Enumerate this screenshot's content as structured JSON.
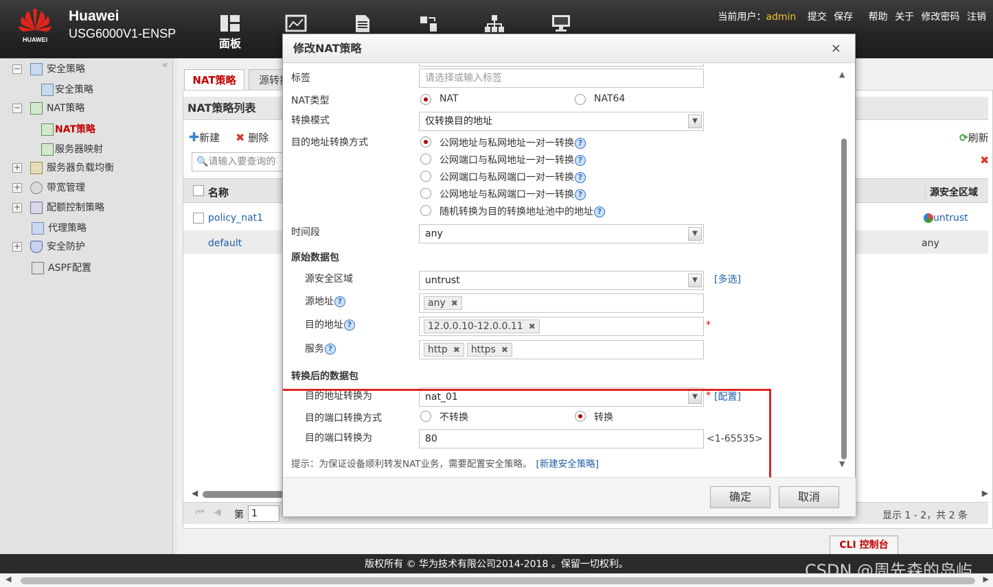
{
  "header": {
    "logo_text": "HUAWEI",
    "brand_line1": "Huawei",
    "brand_line2": "USG6000V1-ENSP",
    "nav": [
      {
        "label": "面板",
        "icon": "dashboard-icon"
      },
      {
        "label": "监控",
        "icon": "monitor-chart-icon"
      },
      {
        "label": "策略",
        "icon": "document-icon"
      },
      {
        "label": "对象",
        "icon": "object-icon"
      },
      {
        "label": "网络",
        "icon": "network-icon"
      },
      {
        "label": "系统",
        "icon": "computer-icon"
      }
    ],
    "user_prefix": "当前用户：",
    "user": "admin",
    "links": [
      "提交",
      "保存",
      "帮助",
      "关于",
      "修改密码",
      "注销"
    ]
  },
  "sidebar": {
    "collapse": "«",
    "items": [
      {
        "label": "安全策略",
        "expander": "−"
      },
      {
        "label": "安全策略"
      },
      {
        "label": "NAT策略",
        "expander": "−"
      },
      {
        "label": "NAT策略"
      },
      {
        "label": "服务器映射"
      },
      {
        "label": "服务器负载均衡",
        "expander": "+"
      },
      {
        "label": "带宽管理",
        "expander": "+"
      },
      {
        "label": "配额控制策略",
        "expander": "+"
      },
      {
        "label": "代理策略"
      },
      {
        "label": "安全防护",
        "expander": "+"
      },
      {
        "label": "ASPF配置"
      }
    ]
  },
  "main": {
    "tabs": [
      "NAT策略",
      "源转换"
    ],
    "list_title": "NAT策略列表",
    "toolbar": {
      "new": "新建",
      "delete": "删除",
      "refresh": "刷新"
    },
    "search_placeholder": "请输入要查询的",
    "columns": {
      "name": "名称",
      "src_zone": "源安全区域"
    },
    "rows": [
      {
        "name": "policy_nat1",
        "src_zone": "untrust"
      },
      {
        "name": "default",
        "src_zone": "any"
      }
    ],
    "pager": {
      "page_label": "第",
      "page": "1",
      "summary": "显示 1 - 2，共 2 条"
    },
    "cli": "CLI 控制台"
  },
  "dialog": {
    "title": "修改NAT策略",
    "close": "×",
    "fields": {
      "label_tag": "标签",
      "tag_placeholder": "请选择或输入标签",
      "label_nat_type": "NAT类型",
      "nat_opt1": "NAT",
      "nat_opt2": "NAT64",
      "label_mode": "转换模式",
      "mode_value": "仅转换目的地址",
      "label_dst_method": "目的地址转换方式",
      "dst_opts": [
        "公网地址与私网地址一对一转换",
        "公网端口与私网地址一对一转换",
        "公网端口与私网端口一对一转换",
        "公网地址与私网端口一对一转换",
        "随机转换为目的转换地址池中的地址"
      ],
      "label_time": "时间段",
      "time_value": "any",
      "section_orig": "原始数据包",
      "label_src_zone": "源安全区域",
      "src_zone_value": "untrust",
      "multi_link": "[多选]",
      "label_src_addr": "源地址",
      "src_addr_tags": [
        "any"
      ],
      "label_dst_addr": "目的地址",
      "dst_addr_tags": [
        "12.0.0.10-12.0.0.11"
      ],
      "label_service": "服务",
      "service_tags": [
        "http",
        "https"
      ],
      "section_trans": "转换后的数据包",
      "label_dst_to": "目的地址转换为",
      "dst_to_value": "nat_01",
      "config_link": "[配置]",
      "label_port_method": "目的端口转换方式",
      "port_opt1": "不转换",
      "port_opt2": "转换",
      "label_port_to": "目的端口转换为",
      "port_value": "80",
      "port_range": "<1-65535>",
      "hint": "提示：为保证设备顺利转发NAT业务，需要配置安全策略。",
      "hint_link": "[新建安全策略]"
    },
    "ok": "确定",
    "cancel": "取消"
  },
  "footer": {
    "copyright": "版权所有 © 华为技术有限公司2014-2018 。保留一切权利。"
  },
  "watermark": "CSDN @周先森的岛屿",
  "colors": {
    "accent_red": "#b40000",
    "highlight_box": "#e0231f",
    "link": "#1f5fa8",
    "admin": "#f0c230"
  }
}
